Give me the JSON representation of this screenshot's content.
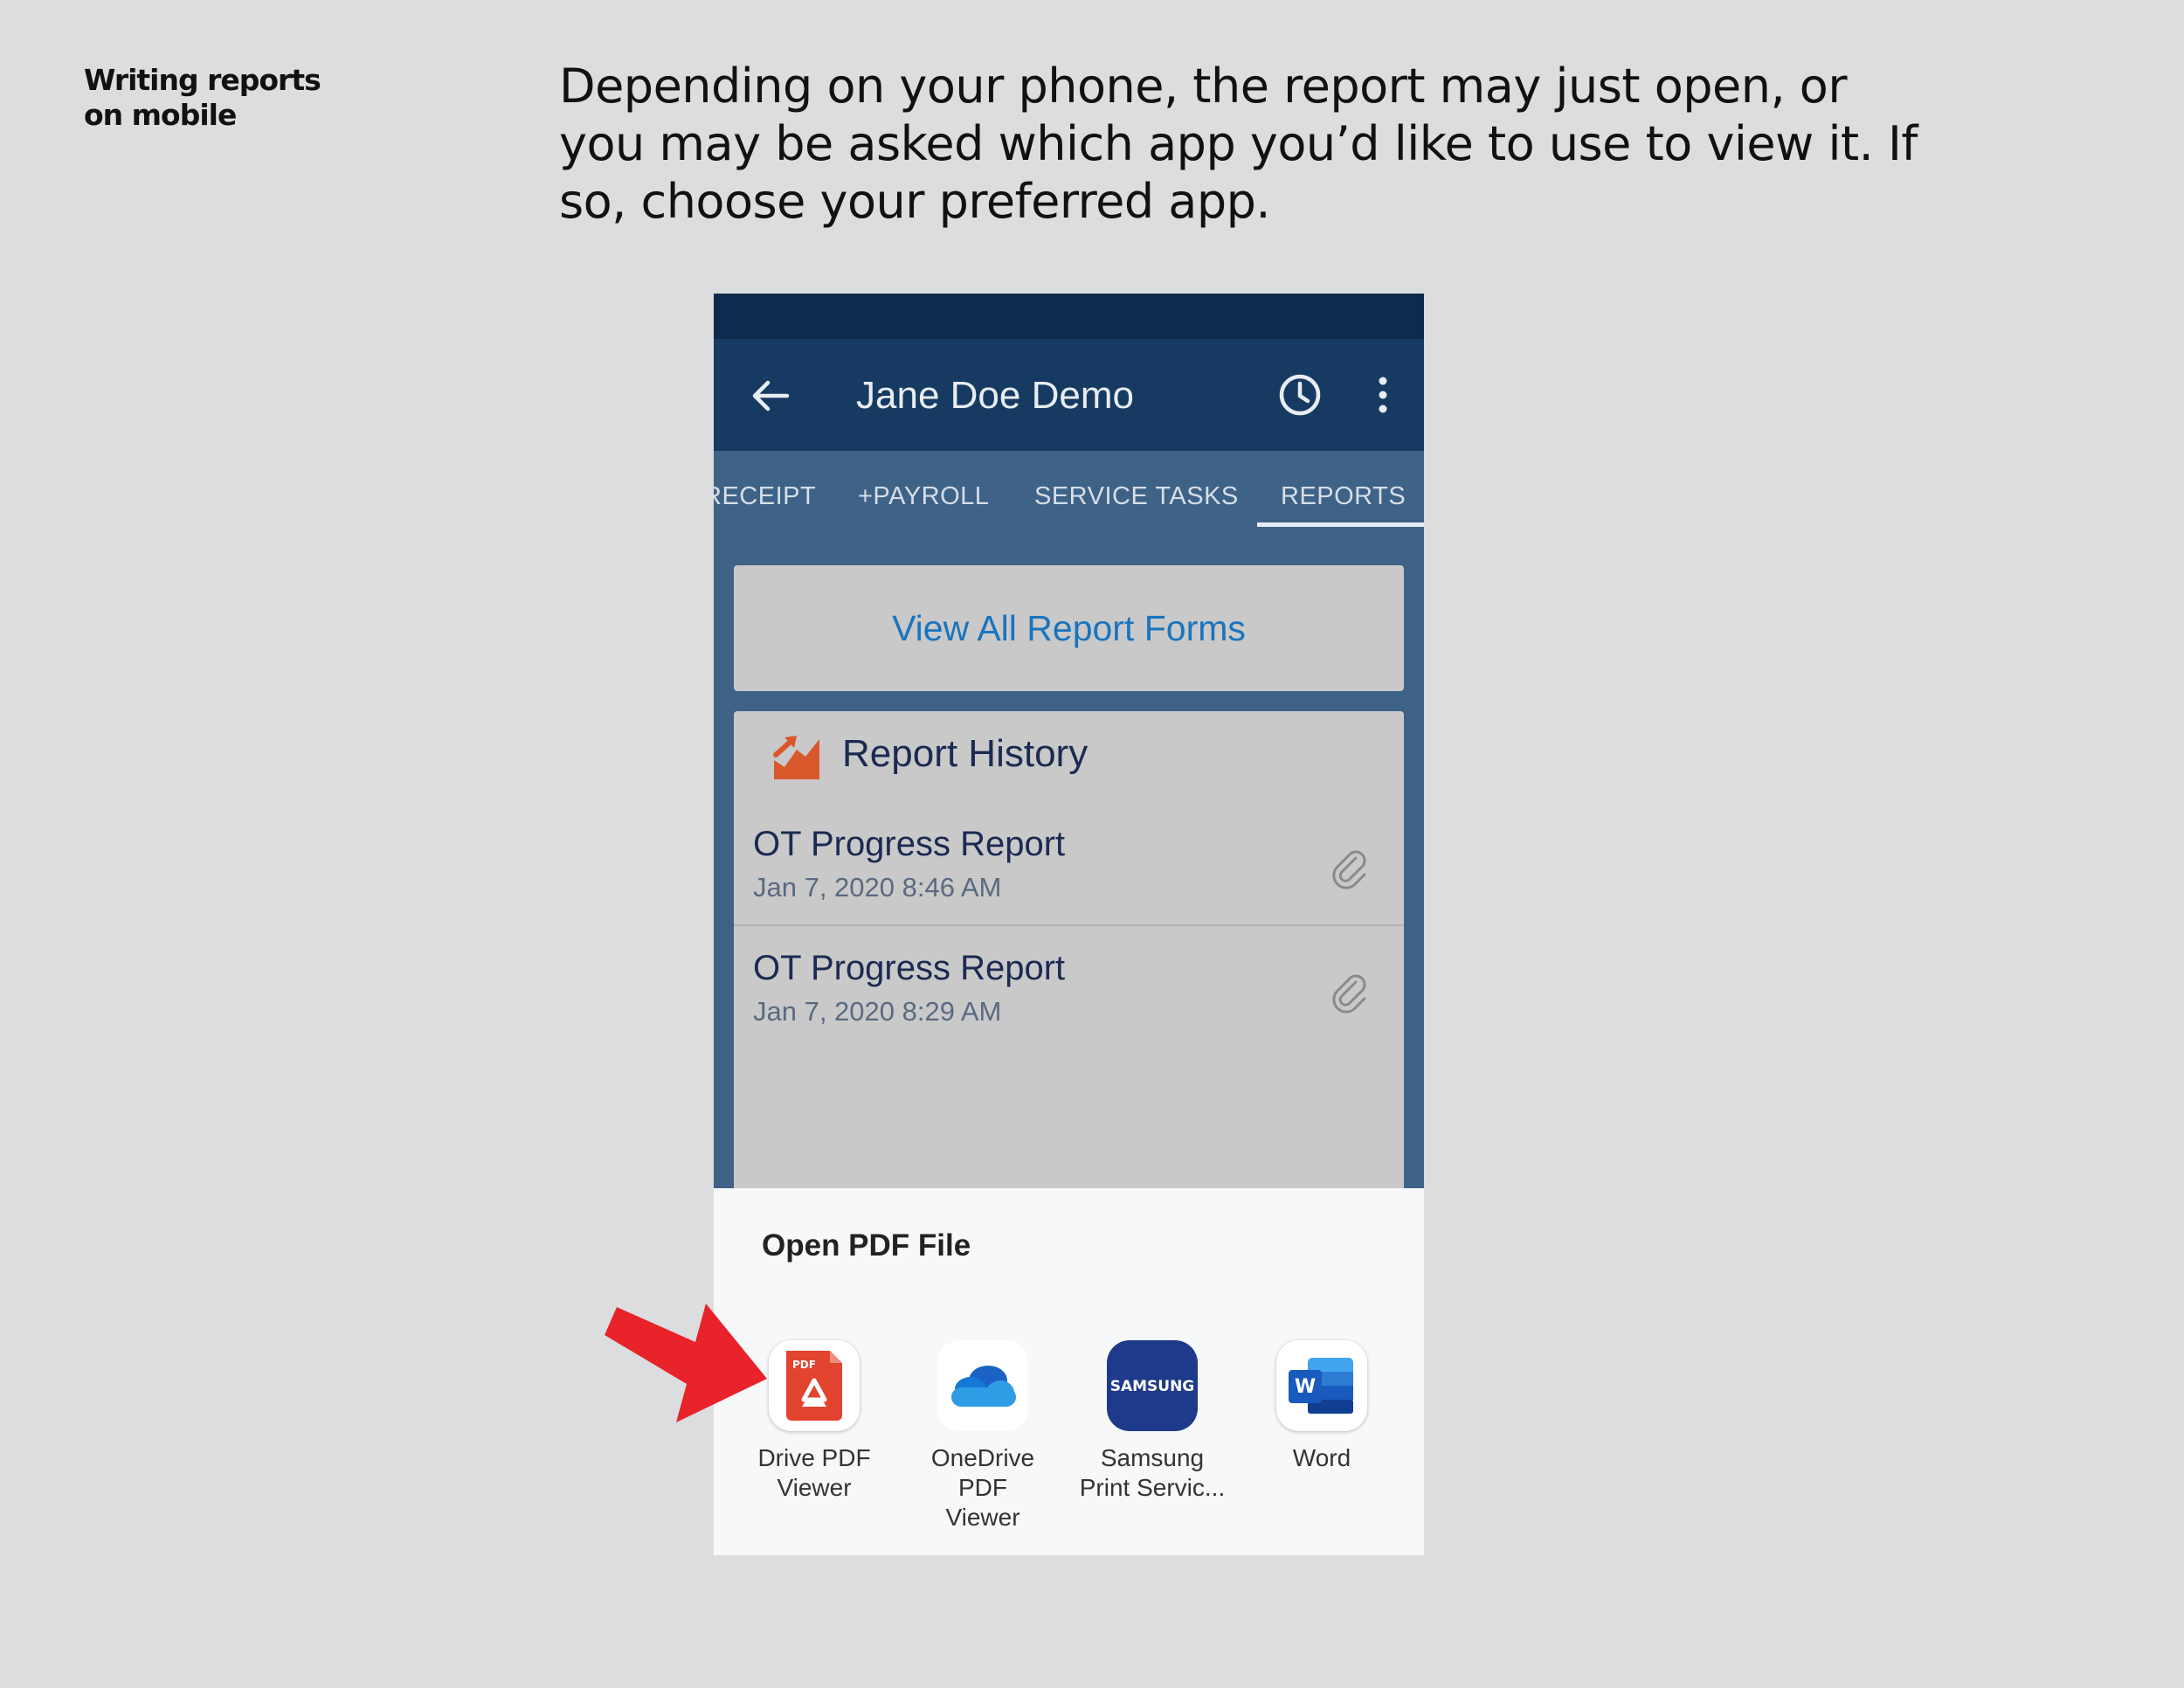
{
  "page": {
    "section_label_line1": "Writing reports",
    "section_label_line2": "on mobile",
    "instruction": "Depending on your phone, the report may just open, or you may be asked which app you’d like to use to view it. If so, choose your preferred app."
  },
  "app_bar": {
    "title": "Jane Doe Demo",
    "back_icon": "arrow-left-icon",
    "history_icon": "clock-icon",
    "menu_icon": "more-vert-icon"
  },
  "tabs": {
    "items": [
      "RECEIPT",
      "+PAYROLL",
      "SERVICE TASKS",
      "REPORTS"
    ],
    "selected": "REPORTS"
  },
  "view_all": {
    "label": "View All Report Forms"
  },
  "report_history": {
    "title": "Report History",
    "icon": "chart-growth-icon",
    "reports": [
      {
        "title": "OT Progress Report",
        "date": "Jan 7, 2020 8:46 AM"
      },
      {
        "title": "OT Progress Report",
        "date": "Jan 7, 2020 8:29 AM"
      }
    ]
  },
  "open_sheet": {
    "title": "Open PDF File",
    "apps": [
      {
        "label_line1": "Drive PDF",
        "label_line2": "Viewer",
        "icon": "drive-pdf-icon"
      },
      {
        "label_line1": "OneDrive PDF",
        "label_line2": "Viewer",
        "icon": "onedrive-icon"
      },
      {
        "label_line1": "Samsung",
        "label_line2": "Print Servic...",
        "icon": "samsung-icon",
        "icon_text": "SAMSUNG"
      },
      {
        "label_line1": "Word",
        "label_line2": "",
        "icon": "word-icon",
        "icon_text": "W"
      }
    ]
  },
  "colors": {
    "background": "#dcdddf",
    "status_bar": "#0e2a4e",
    "app_bar": "#173a62",
    "tab_area": "#3f6287",
    "card": "#c9c9c9",
    "link_blue": "#1a74bd",
    "arrow_red": "#e8232a"
  }
}
